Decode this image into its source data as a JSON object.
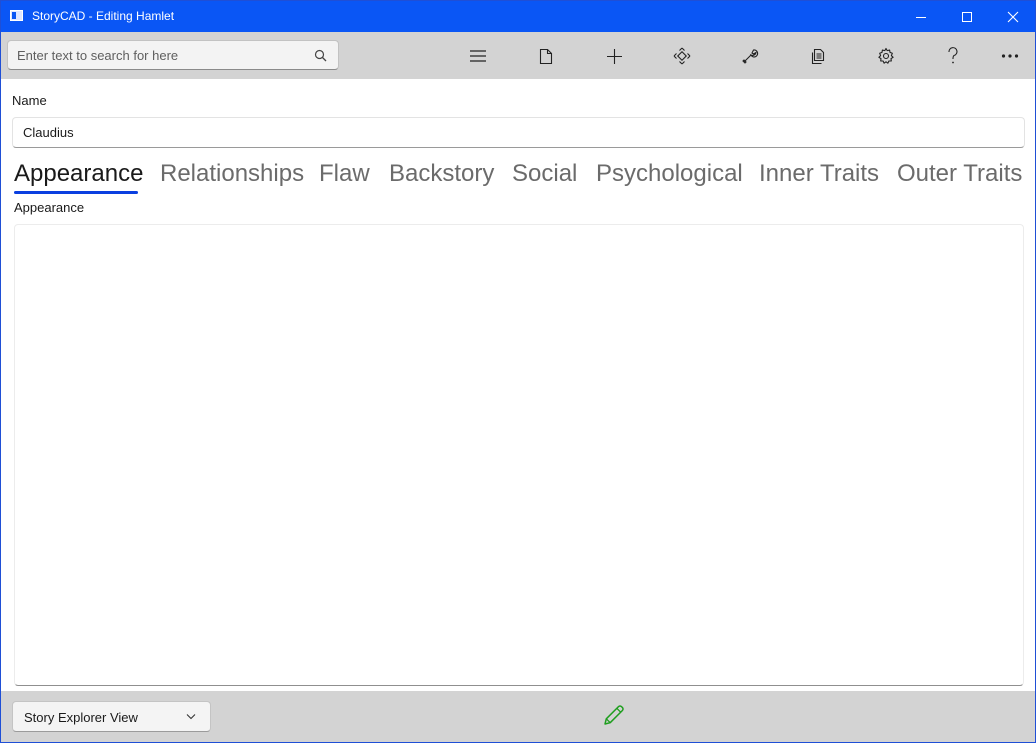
{
  "window": {
    "title": "StoryCAD - Editing Hamlet",
    "title_color": "#0a56f5",
    "controls": [
      "minimize-icon",
      "maximize-icon",
      "close-icon"
    ]
  },
  "toolbar": {
    "search_placeholder": "Enter text to search for here",
    "search_value": "",
    "buttons": [
      "hamburger-menu-icon",
      "new-file-icon",
      "add-icon",
      "move-icon",
      "tools-icon",
      "copy-icon",
      "settings-gear-icon",
      "help-icon",
      "more-icon"
    ]
  },
  "form": {
    "name_label": "Name",
    "name_value": "Claudius",
    "tabs": [
      "Appearance",
      "Relationships",
      "Flaw",
      "Backstory",
      "Social",
      "Psychological",
      "Inner Traits",
      "Outer Traits"
    ],
    "active_tab": "Appearance",
    "accent_color": "#0a3fe0",
    "section_label": "Appearance",
    "appearance_text": ""
  },
  "statusbar": {
    "view_selected": "Story Explorer View",
    "edit_icon": "pencil-icon",
    "edit_icon_color": "#1e9e1e"
  }
}
